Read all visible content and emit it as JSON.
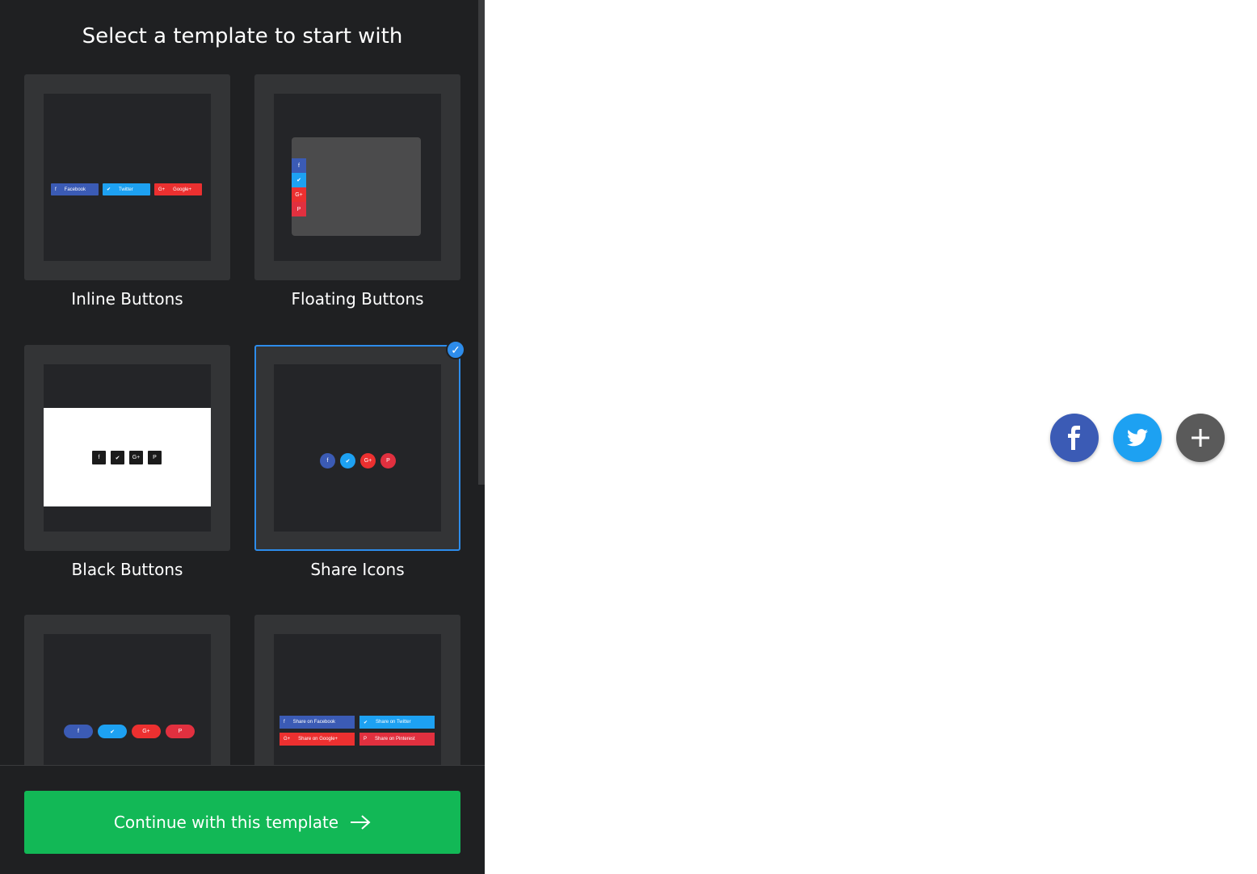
{
  "sidebar": {
    "title": "Select a template to start with",
    "templates": [
      {
        "label": "Inline Buttons",
        "selected": false
      },
      {
        "label": "Floating Buttons",
        "selected": false
      },
      {
        "label": "Black Buttons",
        "selected": false
      },
      {
        "label": "Share Icons",
        "selected": true
      },
      {
        "label": "",
        "selected": false
      },
      {
        "label": "",
        "selected": false
      }
    ],
    "inline_preview": {
      "facebook": "Facebook",
      "twitter": "Twitter",
      "google": "Google+"
    },
    "grid_preview": {
      "facebook": "Share on Facebook",
      "twitter": "Share on Twitter",
      "google": "Share on Google+",
      "pinterest": "Share on Pinterest"
    },
    "continue_label": "Continue with this template"
  },
  "preview": {
    "icons": [
      "facebook-icon",
      "twitter-icon",
      "plus-icon"
    ]
  },
  "colors": {
    "facebook": "#3b5bb5",
    "twitter": "#1da1f2",
    "google": "#ec3030",
    "pinterest": "#e1303f",
    "more": "#5a5a5a",
    "accent": "#2d8ceb",
    "cta": "#12b856"
  }
}
